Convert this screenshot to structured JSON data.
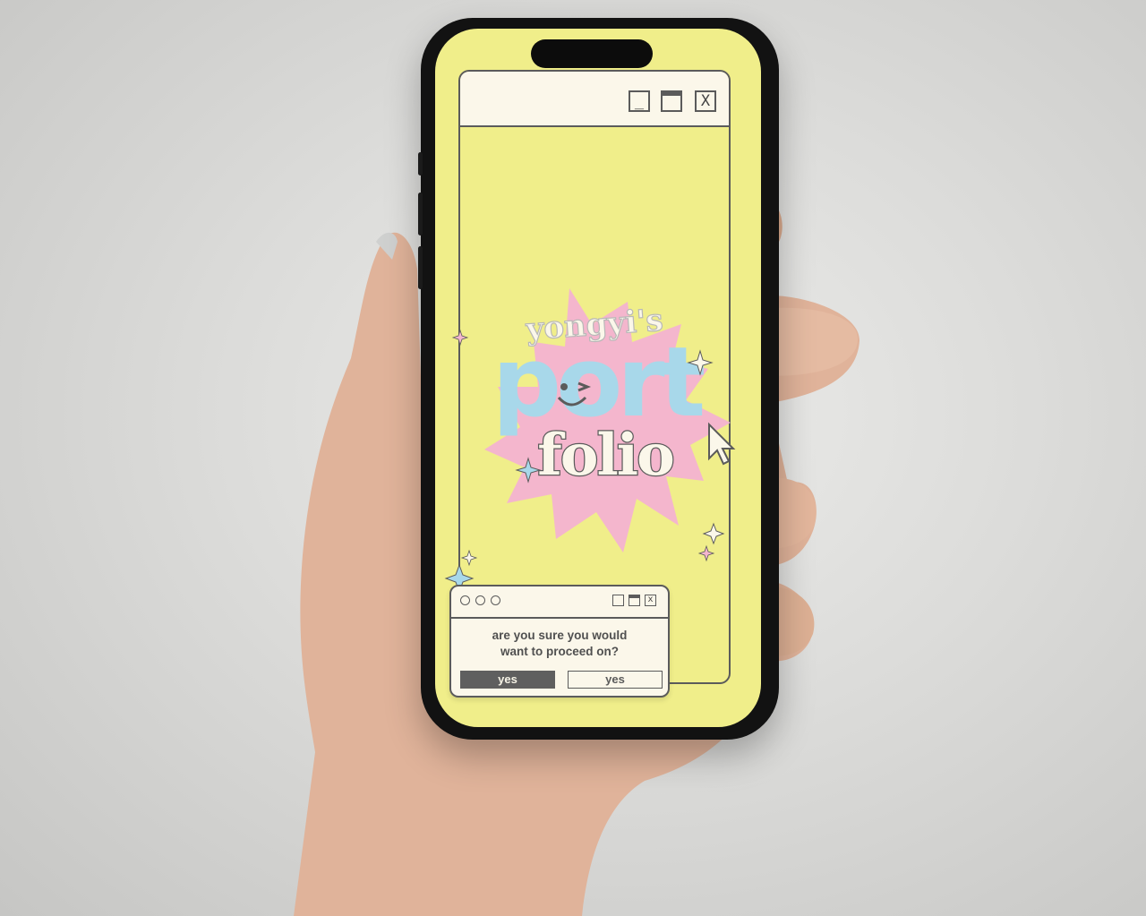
{
  "portfolio": {
    "kicker": "yongyi's",
    "headline": "port",
    "subline": "folio"
  },
  "window": {
    "minimize_glyph": "_",
    "maximize_glyph": "▭",
    "close_glyph": "X"
  },
  "dialog": {
    "message_line1": "are you sure you would",
    "message_line2": "want to proceed on?",
    "primary_label": "yes",
    "secondary_label": "yes",
    "close_glyph": "x"
  },
  "colors": {
    "screen_bg": "#f0ee8a",
    "burst_pink": "#f4b6cd",
    "headline_blue": "#a8d8ea",
    "cream": "#fbf7ea",
    "outline_gray": "#5b5b5b"
  }
}
